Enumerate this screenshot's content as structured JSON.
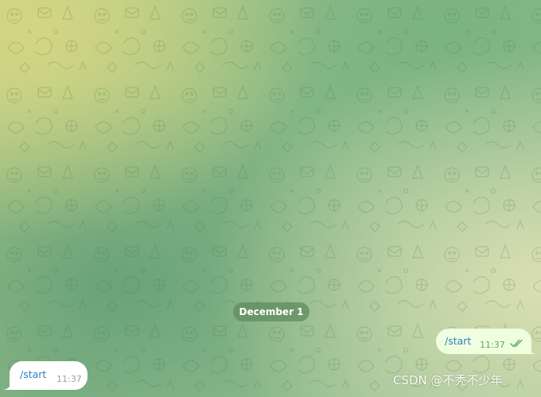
{
  "chat": {
    "date_label": "December 1",
    "messages": [
      {
        "direction": "outgoing",
        "text": "/start",
        "time": "11:37",
        "status": "read-double-check-icon"
      },
      {
        "direction": "incoming",
        "text": "/start",
        "time": "11:37"
      }
    ]
  },
  "watermark": {
    "text": "CSDN @不秃不少年"
  },
  "colors": {
    "outgoing_bubble": "#eefedf",
    "incoming_bubble": "#ffffff",
    "command_link": "#2f7fc6",
    "date_badge": "#5f8c5f",
    "check_marks": "#6aa36c"
  },
  "icons": [
    "doodle-pattern",
    "read-double-check-icon"
  ]
}
